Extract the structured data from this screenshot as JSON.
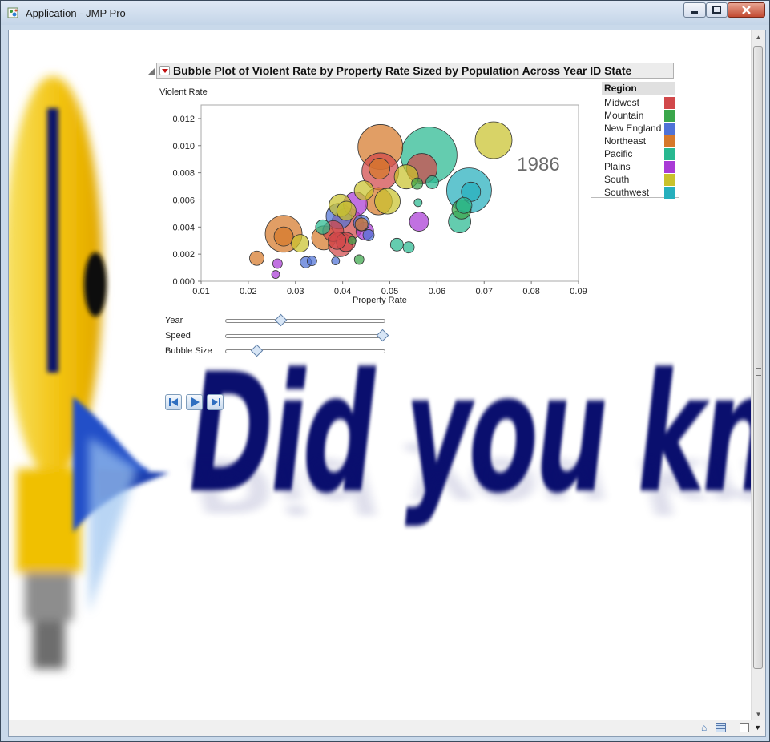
{
  "window": {
    "title": "Application - JMP Pro"
  },
  "background": {
    "tagline": "Did you know..."
  },
  "report": {
    "title": "Bubble Plot of Violent Rate by Property Rate Sized by Population Across Year ID State"
  },
  "chart_data": {
    "type": "scatter",
    "title": "Bubble Plot of Violent Rate by Property Rate Sized by Population Across Year ID State",
    "xlabel": "Property Rate",
    "ylabel": "Violent Rate",
    "xlim": [
      0.01,
      0.09
    ],
    "ylim": [
      0.0,
      0.013
    ],
    "x_ticks": [
      "0.01",
      "0.02",
      "0.03",
      "0.04",
      "0.05",
      "0.06",
      "0.07",
      "0.08",
      "0.09"
    ],
    "y_ticks": [
      "0.000",
      "0.002",
      "0.004",
      "0.006",
      "0.008",
      "0.010",
      "0.012"
    ],
    "year_label": "1986",
    "legend": {
      "title": "Region",
      "entries": [
        {
          "name": "Midwest",
          "color": "#d1484a"
        },
        {
          "name": "Mountain",
          "color": "#3aa64a"
        },
        {
          "name": "New England",
          "color": "#4f72d6"
        },
        {
          "name": "Northeast",
          "color": "#d6782a"
        },
        {
          "name": "Pacific",
          "color": "#28b890"
        },
        {
          "name": "Plains",
          "color": "#a93ad6"
        },
        {
          "name": "South",
          "color": "#c9c22c"
        },
        {
          "name": "Southwest",
          "color": "#26afbd"
        }
      ]
    },
    "points": [
      {
        "x": 0.048,
        "y": 0.0099,
        "r": 28,
        "region": "Northeast"
      },
      {
        "x": 0.0583,
        "y": 0.0093,
        "r": 35,
        "region": "Pacific"
      },
      {
        "x": 0.072,
        "y": 0.0104,
        "r": 23,
        "region": "South"
      },
      {
        "x": 0.0668,
        "y": 0.0067,
        "r": 28,
        "region": "Southwest"
      },
      {
        "x": 0.0672,
        "y": 0.0066,
        "r": 12,
        "region": "Southwest"
      },
      {
        "x": 0.048,
        "y": 0.0081,
        "r": 23,
        "region": "Midwest"
      },
      {
        "x": 0.0568,
        "y": 0.0083,
        "r": 19,
        "region": "Midwest"
      },
      {
        "x": 0.0478,
        "y": 0.0083,
        "r": 13,
        "region": "Northeast"
      },
      {
        "x": 0.0535,
        "y": 0.0077,
        "r": 15,
        "region": "South"
      },
      {
        "x": 0.059,
        "y": 0.0073,
        "r": 8,
        "region": "Pacific"
      },
      {
        "x": 0.0558,
        "y": 0.0072,
        "r": 7,
        "region": "Mountain"
      },
      {
        "x": 0.0476,
        "y": 0.0059,
        "r": 17,
        "region": "Northeast"
      },
      {
        "x": 0.0495,
        "y": 0.0059,
        "r": 16,
        "region": "South"
      },
      {
        "x": 0.0445,
        "y": 0.0067,
        "r": 12,
        "region": "South"
      },
      {
        "x": 0.0427,
        "y": 0.0057,
        "r": 15,
        "region": "Plains"
      },
      {
        "x": 0.0395,
        "y": 0.0056,
        "r": 14,
        "region": "South"
      },
      {
        "x": 0.0408,
        "y": 0.0052,
        "r": 12,
        "region": "South"
      },
      {
        "x": 0.041,
        "y": 0.0042,
        "r": 20,
        "region": "Midwest"
      },
      {
        "x": 0.0392,
        "y": 0.0048,
        "r": 16,
        "region": "New England"
      },
      {
        "x": 0.044,
        "y": 0.0043,
        "r": 10,
        "region": "New England"
      },
      {
        "x": 0.0447,
        "y": 0.0037,
        "r": 11,
        "region": "Plains"
      },
      {
        "x": 0.044,
        "y": 0.0042,
        "r": 8,
        "region": "Northeast"
      },
      {
        "x": 0.0455,
        "y": 0.0034,
        "r": 7,
        "region": "New England"
      },
      {
        "x": 0.0275,
        "y": 0.0035,
        "r": 23,
        "region": "Northeast"
      },
      {
        "x": 0.0275,
        "y": 0.0033,
        "r": 12,
        "region": "Northeast"
      },
      {
        "x": 0.031,
        "y": 0.0028,
        "r": 11,
        "region": "South"
      },
      {
        "x": 0.0358,
        "y": 0.004,
        "r": 9,
        "region": "Pacific"
      },
      {
        "x": 0.036,
        "y": 0.0032,
        "r": 15,
        "region": "Northeast"
      },
      {
        "x": 0.038,
        "y": 0.0037,
        "r": 13,
        "region": "Midwest"
      },
      {
        "x": 0.0388,
        "y": 0.003,
        "r": 11,
        "region": "Midwest"
      },
      {
        "x": 0.0395,
        "y": 0.0027,
        "r": 15,
        "region": "Midwest"
      },
      {
        "x": 0.0407,
        "y": 0.0029,
        "r": 12,
        "region": "Midwest"
      },
      {
        "x": 0.042,
        "y": 0.003,
        "r": 5,
        "region": "Mountain"
      },
      {
        "x": 0.0218,
        "y": 0.0017,
        "r": 9,
        "region": "Northeast"
      },
      {
        "x": 0.0262,
        "y": 0.0013,
        "r": 6,
        "region": "Plains"
      },
      {
        "x": 0.0258,
        "y": 0.0005,
        "r": 5,
        "region": "Plains"
      },
      {
        "x": 0.0322,
        "y": 0.0014,
        "r": 7,
        "region": "New England"
      },
      {
        "x": 0.0335,
        "y": 0.0015,
        "r": 6,
        "region": "New England"
      },
      {
        "x": 0.0385,
        "y": 0.0015,
        "r": 5,
        "region": "New England"
      },
      {
        "x": 0.0435,
        "y": 0.0016,
        "r": 6,
        "region": "Mountain"
      },
      {
        "x": 0.0515,
        "y": 0.0027,
        "r": 8,
        "region": "Pacific"
      },
      {
        "x": 0.054,
        "y": 0.0025,
        "r": 7,
        "region": "Pacific"
      },
      {
        "x": 0.0562,
        "y": 0.0044,
        "r": 12,
        "region": "Plains"
      },
      {
        "x": 0.056,
        "y": 0.0058,
        "r": 5,
        "region": "Pacific"
      },
      {
        "x": 0.0648,
        "y": 0.0044,
        "r": 14,
        "region": "Pacific"
      },
      {
        "x": 0.0652,
        "y": 0.0053,
        "r": 12,
        "region": "Mountain"
      },
      {
        "x": 0.0657,
        "y": 0.0056,
        "r": 10,
        "region": "Pacific"
      }
    ]
  },
  "controls": {
    "year": {
      "label": "Year",
      "value": 0.35
    },
    "speed": {
      "label": "Speed",
      "value": 1.0
    },
    "bubble_size": {
      "label": "Bubble Size",
      "value": 0.2
    }
  }
}
